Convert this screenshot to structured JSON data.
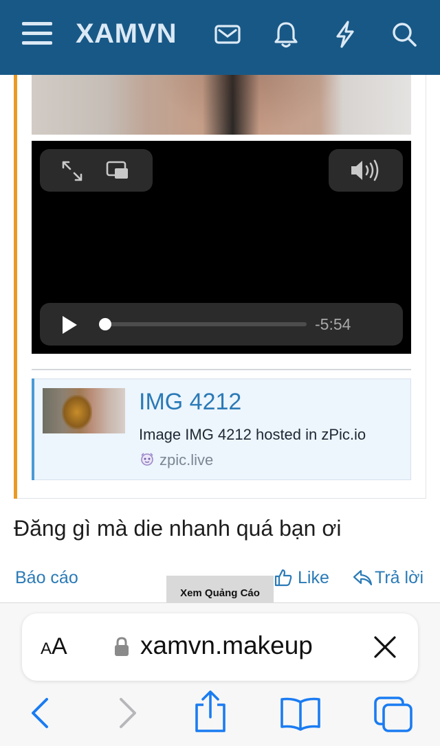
{
  "header": {
    "logo": "XAMVN",
    "icons": [
      "menu-icon",
      "envelope-icon",
      "bell-icon",
      "bolt-icon",
      "search-icon"
    ],
    "background": "#185886"
  },
  "video": {
    "time_remaining": "-5:54",
    "progress": 0.0,
    "controls": [
      "fullscreen-icon",
      "picture-in-picture-icon",
      "volume-icon",
      "play-icon"
    ]
  },
  "embed": {
    "title": "IMG 4212",
    "description": "Image IMG 4212 hosted in zPic.io",
    "site": "zpic.live"
  },
  "post": {
    "reply_text": "Đăng gì mà die nhanh quá bạn ơi",
    "report_label": "Báo cáo",
    "like_label": "Like",
    "reply_label": "Trả lời",
    "accent_color": "#ea9a24"
  },
  "ad": {
    "label": "Xem Quảng Cáo"
  },
  "safari": {
    "text_size_label": "AA",
    "url": "xamvn.makeup"
  }
}
